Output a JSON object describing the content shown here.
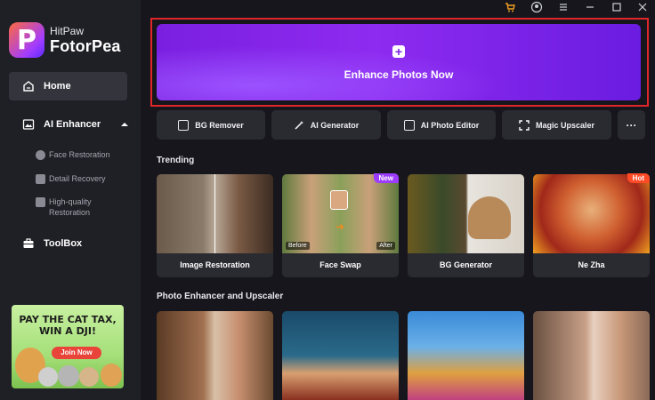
{
  "app": {
    "brand_sub": "HitPaw",
    "brand_main": "FotorPea",
    "logo_letter": "P"
  },
  "titlebar": {
    "icons": [
      "cart-icon",
      "user-icon",
      "menu-icon",
      "minimize-icon",
      "maximize-icon",
      "close-icon"
    ]
  },
  "sidebar": {
    "home": "Home",
    "ai_enhancer": "AI Enhancer",
    "sub_items": [
      "Face Restoration",
      "Detail Recovery",
      "High-quality Restoration"
    ],
    "toolbox": "ToolBox"
  },
  "promo": {
    "title_line1": "PAY THE CAT TAX,",
    "title_line2": "WIN A DJI!",
    "button": "Join Now"
  },
  "hero": {
    "label": "Enhance Photos Now",
    "plus": "+"
  },
  "tools": {
    "bg_remover": "BG Remover",
    "ai_generator": "AI Generator",
    "ai_photo_editor": "AI Photo Editor",
    "magic_upscaler": "Magic Upscaler",
    "more": "···"
  },
  "trending": {
    "title": "Trending",
    "cards": [
      {
        "label": "Image Restoration"
      },
      {
        "label": "Face Swap",
        "badge": "New",
        "before": "Before",
        "after": "After"
      },
      {
        "label": "BG Generator"
      },
      {
        "label": "Ne Zha",
        "badge": "Hot"
      }
    ]
  },
  "photo_section": {
    "title": "Photo Enhancer and Upscaler"
  },
  "colors": {
    "accent": "#8a2be2",
    "hero_border": "#e0262a",
    "badge_new": "#9b3cff",
    "badge_hot": "#ff4a26"
  }
}
